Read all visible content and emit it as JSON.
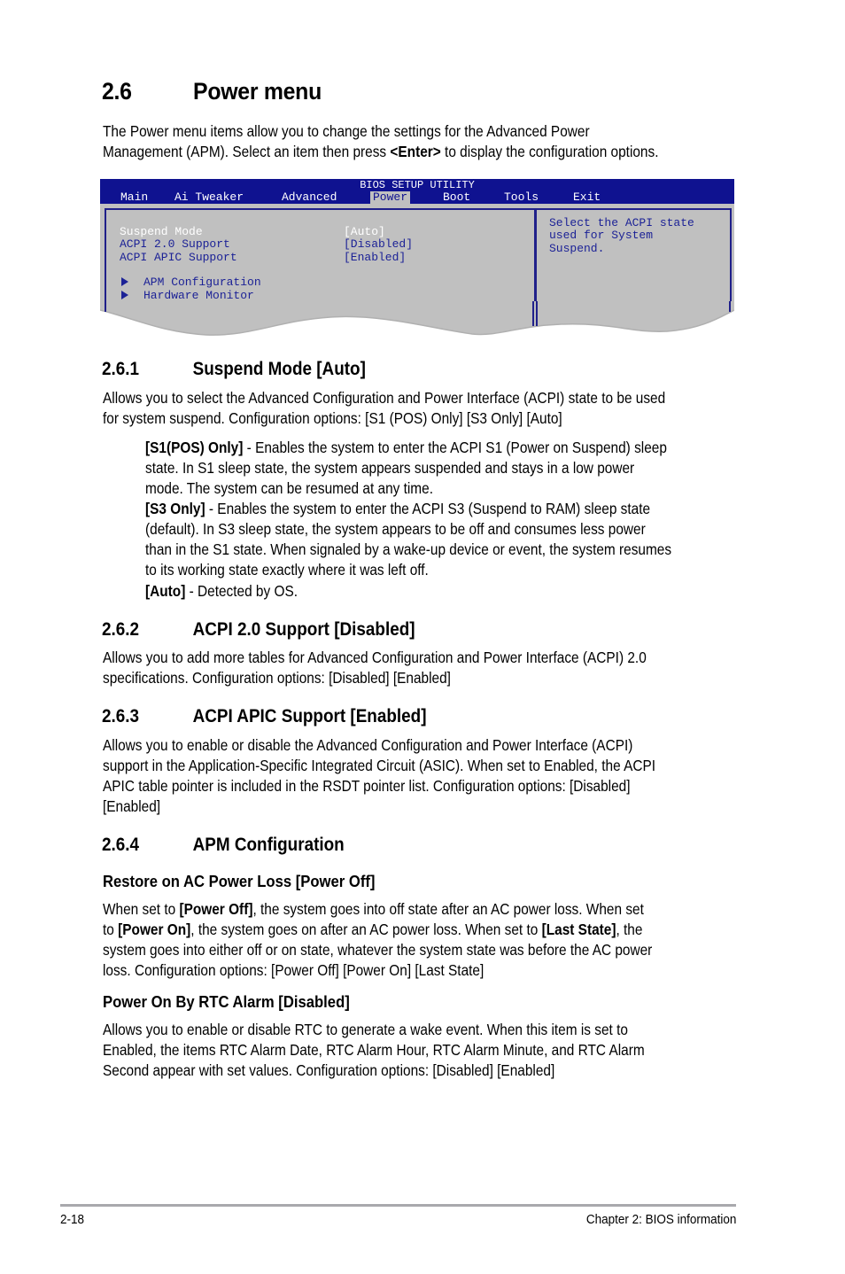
{
  "section": {
    "number": "2.6",
    "title": "Power menu",
    "intro_lines": [
      [
        "The Power menu items allow you to change the settings for the Advanced Power"
      ],
      [
        "Management (APM). Select an item then press ",
        "<Enter>",
        " to display the configuration options."
      ]
    ]
  },
  "bios": {
    "title": "BIOS SETUP UTILITY",
    "tabs": [
      "Main",
      "Ai Tweaker",
      "Advanced",
      "Power",
      "Boot",
      "Tools",
      "Exit"
    ],
    "active_tab": "Power",
    "items": [
      {
        "label": "Suspend Mode",
        "value": "[Auto]",
        "selected": true
      },
      {
        "label": "ACPI 2.0 Support",
        "value": "[Disabled]",
        "selected": false
      },
      {
        "label": "ACPI APIC Support",
        "value": "[Enabled]",
        "selected": false
      }
    ],
    "submenus": [
      "APM Configuration",
      "Hardware Monitor"
    ],
    "help_lines": [
      "Select the ACPI state",
      "used for System",
      "Suspend."
    ],
    "colors": {
      "header": "#0f1290",
      "panel": "#c0c0c0",
      "text": "#1c2296",
      "selected": "#ffffff"
    }
  },
  "s261": {
    "number": "2.6.1",
    "title": "Suspend Mode [Auto]",
    "lines": [
      "Allows you to select the Advanced Configuration and Power Interface (ACPI) state to be used",
      "for system suspend. Configuration options: [S1 (POS) Only] [S3 Only] [Auto]"
    ],
    "options": [
      {
        "label": "[S1(POS) Only]",
        "lines": [
          " - Enables the system to enter the ACPI S1 (Power on Suspend) sleep",
          "state. In S1 sleep state, the system appears suspended and stays in a low power",
          "mode. The system can be resumed at any time."
        ]
      },
      {
        "label": "[S3 Only]",
        "lines": [
          " - Enables the system to enter the ACPI S3 (Suspend to RAM) sleep state",
          "(default). In S3 sleep state, the system appears to be off and consumes less power",
          "than in the S1 state. When signaled by a wake-up device or event, the system resumes",
          "to its working state exactly where it was left off."
        ]
      },
      {
        "label": "[Auto]",
        "lines": [
          " - Detected by OS."
        ]
      }
    ]
  },
  "s262": {
    "number": "2.6.2",
    "title": "ACPI 2.0 Support [Disabled]",
    "lines": [
      "Allows you to add more tables for Advanced Configuration and Power Interface (ACPI) 2.0",
      "specifications. Configuration options: [Disabled] [Enabled]"
    ]
  },
  "s263": {
    "number": "2.6.3",
    "title": "ACPI APIC Support [Enabled]",
    "lines": [
      "Allows you to enable or disable the Advanced Configuration and Power Interface (ACPI)",
      "support in the Application-Specific Integrated Circuit (ASIC). When set to Enabled, the ACPI",
      "APIC table pointer is included in the RSDT pointer list. Configuration options: [Disabled]",
      "[Enabled]"
    ]
  },
  "s264": {
    "number": "2.6.4",
    "title": "APM Configuration",
    "restore": {
      "title": "Restore on AC Power Loss [Power Off]",
      "line1": [
        "When set to ",
        "[Power Off]",
        ", the system goes into off state after an AC power loss. When set"
      ],
      "line2": [
        "to ",
        "[Power On]",
        ", the system goes on after an AC power loss. When set to ",
        "[Last State]",
        ", the"
      ],
      "line3": "system goes into either off or on state, whatever the system state was before the AC power",
      "line4": "loss. Configuration options: [Power Off] [Power On] [Last State]"
    },
    "rtc": {
      "title": "Power On By RTC Alarm [Disabled]",
      "lines": [
        "Allows you to enable or disable RTC to generate a wake event. When this item is set to",
        "Enabled, the items RTC Alarm Date, RTC Alarm Hour, RTC Alarm Minute, and RTC Alarm",
        "Second appear with set values. Configuration options: [Disabled] [Enabled]"
      ]
    }
  },
  "footer": {
    "page": "2-18",
    "chapter": "Chapter 2: BIOS information"
  }
}
